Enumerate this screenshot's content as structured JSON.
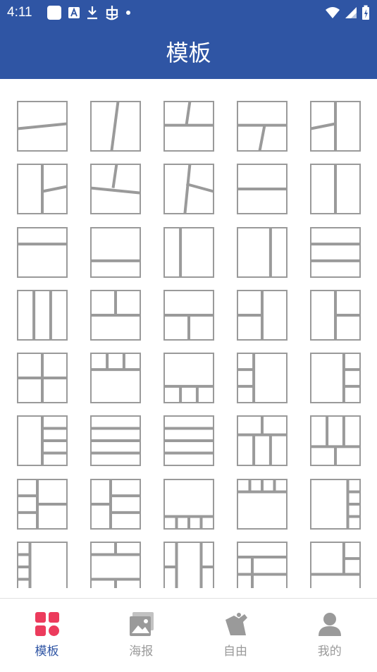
{
  "status_bar": {
    "time": "4:11"
  },
  "app_bar": {
    "title": "模板"
  },
  "grid": {
    "line_color": "#9a9a9a",
    "templates": [
      {
        "lines": [
          [
            0,
            0.55,
            1,
            0.45
          ]
        ]
      },
      {
        "lines": [
          [
            0.55,
            0,
            0.42,
            1
          ]
        ]
      },
      {
        "lines": [
          [
            0,
            0.48,
            1,
            0.48
          ],
          [
            0.52,
            0,
            0.45,
            0.48
          ]
        ]
      },
      {
        "lines": [
          [
            0,
            0.48,
            1,
            0.48
          ],
          [
            0.55,
            0.48,
            0.45,
            1
          ]
        ]
      },
      {
        "lines": [
          [
            0.5,
            0,
            0.5,
            1
          ],
          [
            0,
            0.55,
            0.5,
            0.45
          ]
        ]
      },
      {
        "lines": [
          [
            0.5,
            0,
            0.5,
            1
          ],
          [
            0.5,
            0.55,
            1,
            0.45
          ]
        ]
      },
      {
        "lines": [
          [
            0,
            0.48,
            1,
            0.58
          ],
          [
            0.52,
            0,
            0.45,
            0.48
          ]
        ]
      },
      {
        "lines": [
          [
            0.52,
            0,
            0.42,
            1
          ],
          [
            0.45,
            0.4,
            1,
            0.55
          ]
        ]
      },
      {
        "lines": [
          [
            0,
            0.5,
            1,
            0.5
          ]
        ]
      },
      {
        "lines": [
          [
            0.5,
            0,
            0.5,
            1
          ]
        ]
      },
      {
        "lines": [
          [
            0,
            0.33,
            1,
            0.33
          ]
        ]
      },
      {
        "lines": [
          [
            0,
            0.67,
            1,
            0.67
          ]
        ]
      },
      {
        "lines": [
          [
            0.33,
            0,
            0.33,
            1
          ]
        ]
      },
      {
        "lines": [
          [
            0.67,
            0,
            0.67,
            1
          ]
        ]
      },
      {
        "lines": [
          [
            0,
            0.33,
            1,
            0.33
          ],
          [
            0,
            0.67,
            1,
            0.67
          ]
        ]
      },
      {
        "lines": [
          [
            0.33,
            0,
            0.33,
            1
          ],
          [
            0.67,
            0,
            0.67,
            1
          ]
        ]
      },
      {
        "lines": [
          [
            0,
            0.5,
            1,
            0.5
          ],
          [
            0.5,
            0,
            0.5,
            0.5
          ]
        ]
      },
      {
        "lines": [
          [
            0,
            0.5,
            1,
            0.5
          ],
          [
            0.5,
            0.5,
            0.5,
            1
          ]
        ]
      },
      {
        "lines": [
          [
            0.5,
            0,
            0.5,
            1
          ],
          [
            0,
            0.5,
            0.5,
            0.5
          ]
        ]
      },
      {
        "lines": [
          [
            0.5,
            0,
            0.5,
            1
          ],
          [
            0.5,
            0.5,
            1,
            0.5
          ]
        ]
      },
      {
        "lines": [
          [
            0.5,
            0,
            0.5,
            1
          ],
          [
            0,
            0.5,
            1,
            0.5
          ]
        ]
      },
      {
        "lines": [
          [
            0,
            0.33,
            1,
            0.33
          ],
          [
            0.33,
            0,
            0.33,
            0.33
          ],
          [
            0.67,
            0,
            0.67,
            0.33
          ]
        ]
      },
      {
        "lines": [
          [
            0,
            0.67,
            1,
            0.67
          ],
          [
            0.33,
            0.67,
            0.33,
            1
          ],
          [
            0.67,
            0.67,
            0.67,
            1
          ]
        ]
      },
      {
        "lines": [
          [
            0.33,
            0,
            0.33,
            1
          ],
          [
            0,
            0.33,
            0.33,
            0.33
          ],
          [
            0,
            0.67,
            0.33,
            0.67
          ]
        ]
      },
      {
        "lines": [
          [
            0.67,
            0,
            0.67,
            1
          ],
          [
            0.67,
            0.33,
            1,
            0.33
          ],
          [
            0.67,
            0.67,
            1,
            0.67
          ]
        ]
      },
      {
        "lines": [
          [
            0.5,
            0,
            0.5,
            1
          ],
          [
            0.5,
            0.25,
            1,
            0.25
          ],
          [
            0.5,
            0.5,
            1,
            0.5
          ],
          [
            0.5,
            0.75,
            1,
            0.75
          ]
        ]
      },
      {
        "lines": [
          [
            0,
            0.25,
            1,
            0.25
          ],
          [
            0,
            0.5,
            1,
            0.5
          ],
          [
            0,
            0.75,
            1,
            0.75
          ]
        ]
      },
      {
        "lines": [
          [
            0,
            0.25,
            1,
            0.25
          ],
          [
            0,
            0.5,
            1,
            0.5
          ],
          [
            0,
            0.75,
            1,
            0.75
          ]
        ]
      },
      {
        "lines": [
          [
            0,
            0.38,
            1,
            0.38
          ],
          [
            0.5,
            0,
            0.5,
            0.38
          ],
          [
            0.33,
            0.38,
            0.33,
            1
          ],
          [
            0.67,
            0.38,
            0.67,
            1
          ]
        ]
      },
      {
        "lines": [
          [
            0,
            0.62,
            1,
            0.62
          ],
          [
            0.33,
            0,
            0.33,
            0.62
          ],
          [
            0.67,
            0,
            0.67,
            0.62
          ],
          [
            0.5,
            0.62,
            0.5,
            1
          ]
        ]
      },
      {
        "lines": [
          [
            0.4,
            0,
            0.4,
            1
          ],
          [
            0,
            0.33,
            0.4,
            0.33
          ],
          [
            0,
            0.67,
            0.4,
            0.67
          ],
          [
            0.4,
            0.5,
            1,
            0.5
          ]
        ]
      },
      {
        "lines": [
          [
            0.4,
            0,
            0.4,
            1
          ],
          [
            0.4,
            0.33,
            1,
            0.33
          ],
          [
            0.4,
            0.67,
            1,
            0.67
          ],
          [
            0,
            0.5,
            0.4,
            0.5
          ]
        ]
      },
      {
        "lines": [
          [
            0,
            0.75,
            1,
            0.75
          ],
          [
            0.25,
            0.75,
            0.25,
            1
          ],
          [
            0.5,
            0.75,
            0.5,
            1
          ],
          [
            0.75,
            0.75,
            0.75,
            1
          ]
        ]
      },
      {
        "lines": [
          [
            0,
            0.25,
            1,
            0.25
          ],
          [
            0.25,
            0,
            0.25,
            0.25
          ],
          [
            0.5,
            0,
            0.5,
            0.25
          ],
          [
            0.75,
            0,
            0.75,
            0.25
          ]
        ]
      },
      {
        "lines": [
          [
            0.75,
            0,
            0.75,
            1
          ],
          [
            0.75,
            0.25,
            1,
            0.25
          ],
          [
            0.75,
            0.5,
            1,
            0.5
          ],
          [
            0.75,
            0.75,
            1,
            0.75
          ]
        ]
      },
      {
        "lines": [
          [
            0.25,
            0,
            0.25,
            1
          ],
          [
            0,
            0.25,
            0.25,
            0.25
          ],
          [
            0,
            0.5,
            0.25,
            0.5
          ],
          [
            0,
            0.75,
            0.25,
            0.75
          ]
        ]
      },
      {
        "lines": [
          [
            0,
            0.25,
            1,
            0.25
          ],
          [
            0,
            0.75,
            1,
            0.75
          ],
          [
            0.5,
            0,
            0.5,
            0.25
          ],
          [
            0.5,
            0.75,
            0.5,
            1
          ]
        ]
      },
      {
        "lines": [
          [
            0.25,
            0,
            0.25,
            1
          ],
          [
            0.75,
            0,
            0.75,
            1
          ],
          [
            0,
            0.5,
            0.25,
            0.5
          ],
          [
            0.75,
            0.5,
            1,
            0.5
          ]
        ]
      },
      {
        "lines": [
          [
            0,
            0.3,
            1,
            0.3
          ],
          [
            0.3,
            0.3,
            0.3,
            1
          ],
          [
            0.3,
            0.65,
            1,
            0.65
          ],
          [
            0,
            0.65,
            0.3,
            0.65
          ]
        ]
      },
      {
        "lines": [
          [
            0,
            0.65,
            1,
            0.65
          ],
          [
            0.67,
            0,
            0.67,
            0.65
          ],
          [
            0.67,
            0.33,
            1,
            0.33
          ]
        ]
      }
    ]
  },
  "bottom_nav": {
    "active_color": "#ec3b5c",
    "inactive_color": "#9a9a9a",
    "items": [
      {
        "label": "模板",
        "icon": "template-grid-icon",
        "active": true
      },
      {
        "label": "海报",
        "icon": "poster-image-icon",
        "active": false
      },
      {
        "label": "自由",
        "icon": "free-collage-icon",
        "active": false
      },
      {
        "label": "我的",
        "icon": "profile-person-icon",
        "active": false
      }
    ]
  }
}
